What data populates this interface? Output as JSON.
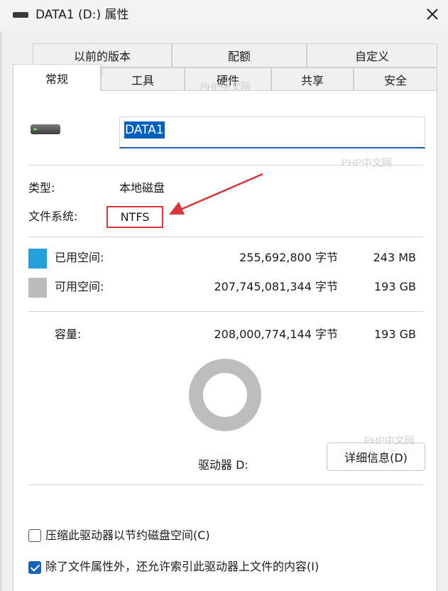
{
  "window": {
    "title": "DATA1 (D:) 属性"
  },
  "tabs": {
    "row1": [
      "以前的版本",
      "配额",
      "自定义"
    ],
    "row2": [
      "常规",
      "工具",
      "硬件",
      "共享",
      "安全"
    ],
    "active": "常规"
  },
  "general": {
    "volume_name": "DATA1",
    "type_label": "类型:",
    "type_value": "本地磁盘",
    "fs_label": "文件系统:",
    "fs_value": "NTFS",
    "used": {
      "label": "已用空间:",
      "bytes": "255,692,800 字节",
      "size": "243 MB",
      "color": "#26a0da"
    },
    "free": {
      "label": "可用空间:",
      "bytes": "207,745,081,344 字节",
      "size": "193 GB",
      "color": "#bcbcbc"
    },
    "capacity": {
      "label": "容量:",
      "bytes": "208,000,774,144 字节",
      "size": "193 GB"
    },
    "drive_label": "驱动器 D:",
    "details_button": "详细信息(D)",
    "compress_option": {
      "label": "压缩此驱动器以节约磁盘空间(C)",
      "checked": false
    },
    "index_option": {
      "label": "除了文件属性外，还允许索引此驱动器上文件的内容(I)",
      "checked": true
    }
  },
  "watermark": "PHP中文网",
  "colors": {
    "accent": "#1a63b7",
    "annotation": "#d9373b"
  }
}
